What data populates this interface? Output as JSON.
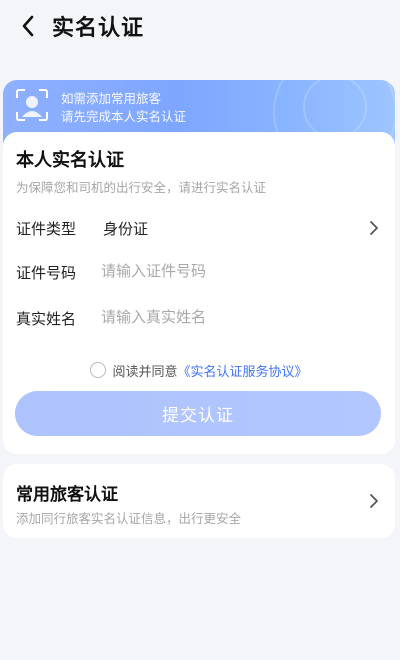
{
  "nav": {
    "title": "实名认证",
    "back_icon": "chevron-left-icon"
  },
  "banner": {
    "line1": "如需添加常用旅客",
    "line2": "请先完成本人实名认证",
    "icon": "face-scan-icon"
  },
  "self_verify": {
    "title": "本人实名认证",
    "subtitle": "为保障您和司机的出行安全，请进行实名认证",
    "fields": {
      "id_type": {
        "label": "证件类型",
        "value": "身份证",
        "icon": "chevron-right-icon"
      },
      "id_number": {
        "label": "证件号码",
        "placeholder": "请输入证件号码"
      },
      "real_name": {
        "label": "真实姓名",
        "placeholder": "请输入真实姓名"
      }
    },
    "agreement": {
      "prefix": "阅读并同意",
      "link": "《实名认证服务协议》",
      "checked": false
    },
    "submit_label": "提交认证"
  },
  "frequent": {
    "title": "常用旅客认证",
    "subtitle": "添加同行旅客实名认证信息，出行更安全",
    "icon": "chevron-right-icon"
  },
  "colors": {
    "accent": "#3f73f3",
    "button": "#aec3fb",
    "banner": "#7ea6ff",
    "background": "#f4f5f8"
  }
}
